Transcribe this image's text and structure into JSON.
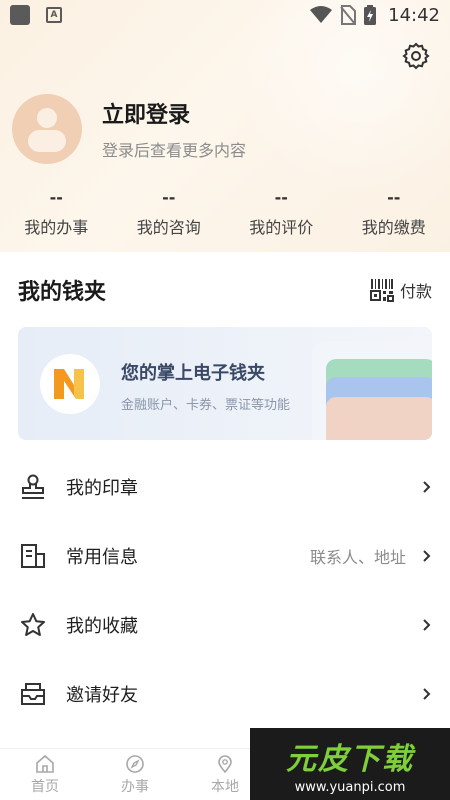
{
  "status_bar": {
    "time": "14:42"
  },
  "profile": {
    "title": "立即登录",
    "subtitle": "登录后查看更多内容"
  },
  "stats": [
    {
      "value": "--",
      "label": "我的办事"
    },
    {
      "value": "--",
      "label": "我的咨询"
    },
    {
      "value": "--",
      "label": "我的评价"
    },
    {
      "value": "--",
      "label": "我的缴费"
    }
  ],
  "wallet": {
    "title": "我的钱夹",
    "pay_label": "付款",
    "card_title": "您的掌上电子钱夹",
    "card_subtitle": "金融账户、卡券、票证等功能"
  },
  "menu": [
    {
      "label": "我的印章",
      "hint": "",
      "icon": "stamp-icon"
    },
    {
      "label": "常用信息",
      "hint": "联系人、地址",
      "icon": "info-card-icon"
    },
    {
      "label": "我的收藏",
      "hint": "",
      "icon": "star-icon"
    },
    {
      "label": "邀请好友",
      "hint": "",
      "icon": "invite-mail-icon"
    }
  ],
  "tabbar": [
    {
      "label": "首页",
      "icon": "home-icon"
    },
    {
      "label": "办事",
      "icon": "compass-icon"
    },
    {
      "label": "本地",
      "icon": "location-icon"
    }
  ],
  "watermark": {
    "text": "元皮下载",
    "url": "www.yuanpi.com"
  },
  "colors": {
    "header_bg": "#fbf1e2",
    "avatar": "#f0cfb4",
    "logo_orange": "#f39a1e",
    "card_bg": "#e6edf7"
  }
}
